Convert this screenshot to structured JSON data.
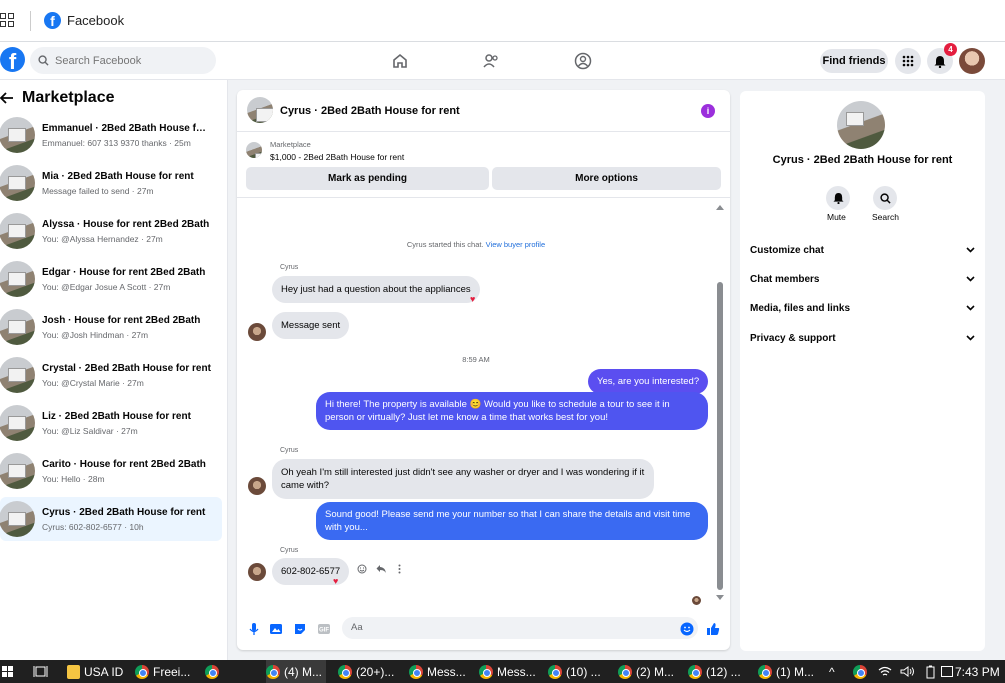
{
  "app": {
    "title": "Facebook"
  },
  "search": {
    "placeholder": "Search Facebook"
  },
  "header": {
    "find_friends": "Find friends",
    "notifications_count": "4"
  },
  "marketplace": {
    "title": "Marketplace",
    "conversations": [
      {
        "name": "Emmanuel · 2Bed 2Bath House for...",
        "preview": "Emmanuel: 607 313 9370 thanks · 25m"
      },
      {
        "name": "Mia · 2Bed 2Bath House for rent",
        "preview": "Message failed to send · 27m"
      },
      {
        "name": "Alyssa · House for rent 2Bed 2Bath",
        "preview": "You: @Alyssa Hernandez · 27m"
      },
      {
        "name": "Edgar · House for rent 2Bed 2Bath",
        "preview": "You: @Edgar Josue A Scott · 27m"
      },
      {
        "name": "Josh · House for rent 2Bed 2Bath",
        "preview": "You: @Josh Hindman · 27m"
      },
      {
        "name": "Crystal · 2Bed 2Bath House for rent",
        "preview": "You: @Crystal Marie · 27m"
      },
      {
        "name": "Liz · 2Bed 2Bath House for rent",
        "preview": "You: @Liz Saldivar · 27m"
      },
      {
        "name": "Carito · House for rent 2Bed 2Bath",
        "preview": "You: Hello · 28m"
      },
      {
        "name": "Cyrus · 2Bed 2Bath House for rent",
        "preview": "Cyrus: 602-802-6577 · 10h"
      }
    ]
  },
  "chat": {
    "title": "Cyrus · 2Bed 2Bath House for rent",
    "info_glyph": "i",
    "listing_source": "Marketplace",
    "listing_price": "$1,000 - 2Bed 2Bath House for rent",
    "mark_pending": "Mark as pending",
    "more_options": "More options",
    "started_text": "Cyrus started this chat.",
    "view_profile": "View buyer profile",
    "sender_name": "Cyrus",
    "msg1": "Hey just had a question about the appliances",
    "msg2": "Message sent",
    "time": "8:59 AM",
    "out1": "Yes, are you interested?",
    "out2": "Hi there! The property is available 😊 Would you like to schedule a tour to see it in person or virtually? Just let me know a time that works best for you!",
    "msg3": "Oh yeah I'm still interested just didn't see any washer or dryer and I was wondering if it came with?",
    "out3": "Sound good! Please send me your number so that I can share the details and visit time with you...",
    "msg4": "602-802-6577",
    "heart": "♥",
    "composer_placeholder": "Aa"
  },
  "details": {
    "name": "Cyrus · 2Bed 2Bath House for rent",
    "mute": "Mute",
    "search": "Search",
    "sections": [
      "Customize chat",
      "Chat members",
      "Media, files and links",
      "Privacy & support"
    ]
  },
  "taskbar": {
    "items": [
      "USA ID",
      "Freei...",
      "",
      "(4) M...",
      "(20+)...",
      "Mess...",
      "Mess...",
      "(10) ...",
      "(2) M...",
      "(12) ...",
      "(1) M..."
    ],
    "clock": "7:43 PM"
  },
  "colors": {
    "brand": "#1877f2",
    "outgoing": "#4a5cf1",
    "badge": "#e41e3f"
  }
}
